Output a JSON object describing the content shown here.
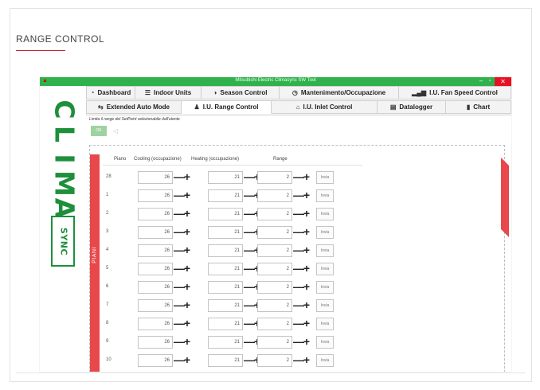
{
  "section": {
    "title": "RANGE CONTROL"
  },
  "window": {
    "title": "Mitsubishi Electric Climasync SW Tool",
    "min": "–",
    "max": "▫",
    "close": "✕"
  },
  "logo": {
    "clima": [
      "C",
      "L",
      "I",
      "M",
      "A"
    ],
    "sync": "SYNC"
  },
  "tabs_row1": [
    {
      "label": "Dashboard",
      "icon": "dashboard-icon",
      "glyph": "◔"
    },
    {
      "label": "Indoor Units",
      "icon": "list-icon",
      "glyph": "☰"
    },
    {
      "label": "Season Control",
      "icon": "half-circle-icon",
      "glyph": "◑"
    },
    {
      "label": "Mantenimento/Occupazione",
      "icon": "clock-icon",
      "glyph": "◷"
    },
    {
      "label": "I.U. Fan Speed Control",
      "icon": "signal-bars-icon",
      "glyph": "▂▄▆"
    }
  ],
  "tabs_row2": [
    {
      "label": "Extended Auto Mode",
      "icon": "swap-icon",
      "glyph": "⇆"
    },
    {
      "label": "I.U. Range Control",
      "icon": "user-settings-icon",
      "glyph": "♟"
    },
    {
      "label": "I.U. Inlet Control",
      "icon": "home-icon",
      "glyph": "⌂"
    },
    {
      "label": "Datalogger",
      "icon": "document-icon",
      "glyph": "▤"
    },
    {
      "label": "Chart",
      "icon": "bar-chart-icon",
      "glyph": "▮"
    }
  ],
  "content": {
    "hint": "Limita il range del SetPoint selezionabile dall'utente",
    "ok_label": "OK",
    "back_glyph": "◁",
    "side_label": "PIANI",
    "headers": {
      "piano": "Piano",
      "cooling": "Cooling (occupazione)",
      "heating": "Heating (occupazione)",
      "range": "Range"
    },
    "minus": "—",
    "plus": "+",
    "invia": "Invia",
    "rows": [
      {
        "piano": "28",
        "cooling": "26",
        "heating": "21",
        "range": "2"
      },
      {
        "piano": "1",
        "cooling": "26",
        "heating": "21",
        "range": "2"
      },
      {
        "piano": "2",
        "cooling": "26",
        "heating": "21",
        "range": "2"
      },
      {
        "piano": "3",
        "cooling": "26",
        "heating": "21",
        "range": "2"
      },
      {
        "piano": "4",
        "cooling": "26",
        "heating": "21",
        "range": "2"
      },
      {
        "piano": "5",
        "cooling": "26",
        "heating": "21",
        "range": "2"
      },
      {
        "piano": "6",
        "cooling": "26",
        "heating": "21",
        "range": "2"
      },
      {
        "piano": "7",
        "cooling": "26",
        "heating": "21",
        "range": "2"
      },
      {
        "piano": "8",
        "cooling": "26",
        "heating": "21",
        "range": "2"
      },
      {
        "piano": "9",
        "cooling": "26",
        "heating": "21",
        "range": "2"
      },
      {
        "piano": "10",
        "cooling": "26",
        "heating": "21",
        "range": "2"
      }
    ]
  },
  "colors": {
    "accent_green": "#2fb24c",
    "logo_green": "#1e8f3a",
    "accent_red": "#e8474b",
    "ok_green": "#9ed39f"
  }
}
